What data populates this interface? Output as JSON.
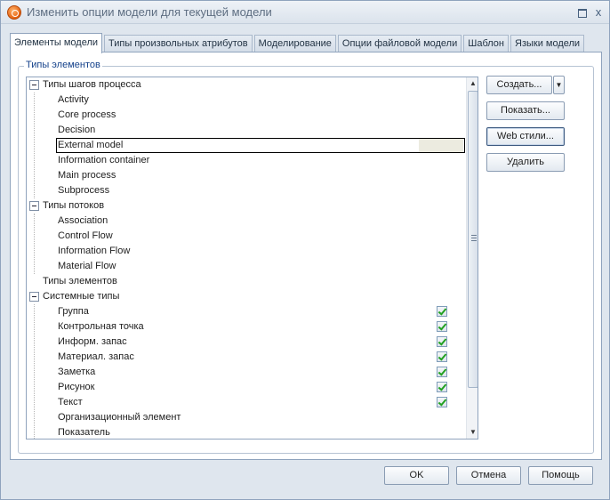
{
  "window": {
    "title": "Изменить опции модели для текущей модели",
    "close_glyph": "x"
  },
  "tabs": [
    {
      "label": "Элементы модели",
      "active": true
    },
    {
      "label": "Типы произвольных атрибутов",
      "active": false
    },
    {
      "label": "Моделирование",
      "active": false
    },
    {
      "label": "Опции файловой модели",
      "active": false
    },
    {
      "label": "Шаблон",
      "active": false
    },
    {
      "label": "Языки модели",
      "active": false
    }
  ],
  "group": {
    "title": "Типы элементов"
  },
  "tree": {
    "rows": [
      {
        "label": "Типы шагов процесса",
        "level": 0,
        "expander": true
      },
      {
        "label": "Activity",
        "level": 1
      },
      {
        "label": "Core process",
        "level": 1
      },
      {
        "label": "Decision",
        "level": 1
      },
      {
        "label": "External model",
        "level": 1,
        "selected": true
      },
      {
        "label": "Information container",
        "level": 1
      },
      {
        "label": "Main process",
        "level": 1
      },
      {
        "label": "Subprocess",
        "level": 1
      },
      {
        "label": "Типы потоков",
        "level": 0,
        "expander": true
      },
      {
        "label": "Association",
        "level": 1
      },
      {
        "label": "Control Flow",
        "level": 1
      },
      {
        "label": "Information Flow",
        "level": 1
      },
      {
        "label": "Material Flow",
        "level": 1
      },
      {
        "label": "Типы элементов",
        "level": 0
      },
      {
        "label": "Системные типы",
        "level": 0,
        "expander": true
      },
      {
        "label": "Группа",
        "level": 1,
        "checked": true
      },
      {
        "label": "Контрольная точка",
        "level": 1,
        "checked": true
      },
      {
        "label": "Информ. запас",
        "level": 1,
        "checked": true
      },
      {
        "label": "Материал. запас",
        "level": 1,
        "checked": true
      },
      {
        "label": "Заметка",
        "level": 1,
        "checked": true
      },
      {
        "label": "Рисунок",
        "level": 1,
        "checked": true
      },
      {
        "label": "Текст",
        "level": 1,
        "checked": true
      },
      {
        "label": "Организационный элемент",
        "level": 1
      },
      {
        "label": "Показатель",
        "level": 1
      }
    ],
    "scroll_up_glyph": "▲",
    "scroll_down_glyph": "▼"
  },
  "side_buttons": {
    "create": "Создать...",
    "create_dropdown_glyph": "▼",
    "show": "Показать...",
    "web_styles": "Web стили...",
    "delete": "Удалить"
  },
  "footer_buttons": {
    "ok": "OK",
    "cancel": "Отмена",
    "help": "Помощь"
  },
  "colors": {
    "accent": "#15428b",
    "window_bg": "#dfe6ee",
    "check": "#21a121",
    "selection_fill": "#ecebe0"
  }
}
